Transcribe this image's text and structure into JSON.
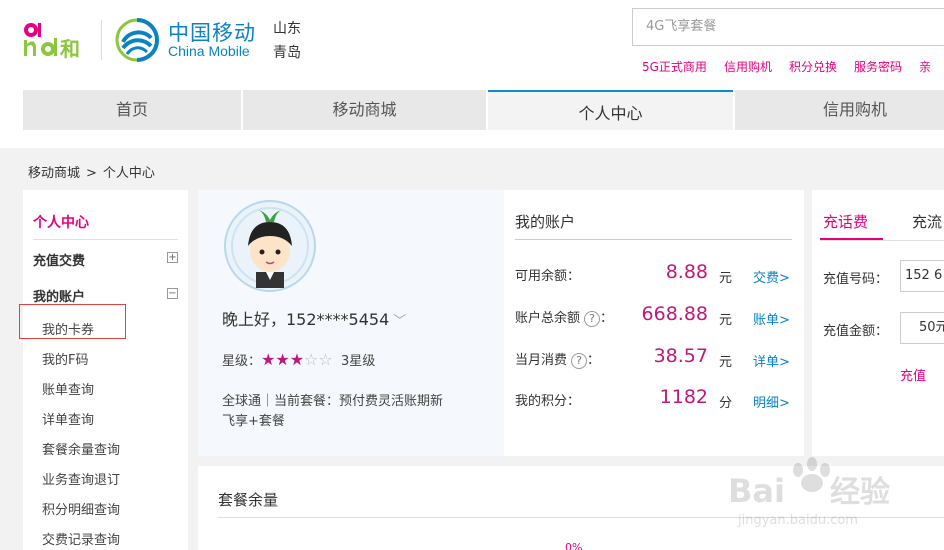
{
  "header": {
    "brand_cn": "中国移动",
    "brand_en": "China Mobile",
    "province": "山东",
    "city": "青岛",
    "search_placeholder": "4G飞享套餐",
    "quick_links": [
      "5G正式商用",
      "信用购机",
      "积分兑换",
      "服务密码",
      "亲"
    ]
  },
  "nav": {
    "items": [
      "首页",
      "移动商城",
      "个人中心",
      "信用购机"
    ],
    "active_index": 2
  },
  "breadcrumb": {
    "parent": "移动商城",
    "separator": ">",
    "current": "个人中心"
  },
  "sidebar": {
    "title": "个人中心",
    "group_recharge": "充值交费",
    "group_account": "我的账户",
    "toggle_plus": "+",
    "toggle_minus": "−",
    "items": [
      "我的卡券",
      "我的F码",
      "账单查询",
      "详单查询",
      "套餐余量查询",
      "业务查询退订",
      "积分明细查询",
      "交费记录查询"
    ],
    "highlighted_item": "我的卡券"
  },
  "profile": {
    "greeting": "晚上好，152****5454",
    "level_label": "星级：",
    "stars_filled": 3,
    "stars_total": 5,
    "level_text": "3星级",
    "package_line1": "全球通｜当前套餐：预付费灵活账期新",
    "package_line2": "飞享+套餐"
  },
  "account": {
    "title": "我的账户",
    "rows": [
      {
        "label": "可用余额：",
        "value": "8.88",
        "unit": "元",
        "link": "交费>"
      },
      {
        "label": "账户总余额",
        "value": "668.88",
        "unit": "元",
        "link": "账单>"
      },
      {
        "label": "当月消费",
        "value": "38.57",
        "unit": "元",
        "link": "详单>"
      },
      {
        "label": "我的积分：",
        "value": "1182",
        "unit": "分",
        "link": "明细>"
      }
    ],
    "help_glyph": "?",
    "colon": "："
  },
  "recharge": {
    "tab_phone": "充话费",
    "tab_data": "充流",
    "number_label": "充值号码：",
    "number_value": "152 6",
    "amount_label": "充值金额：",
    "amount_value": "50元",
    "submit": "充值"
  },
  "balance": {
    "title": "套餐余量",
    "percent": "0%"
  },
  "colors": {
    "accent_pink": "#e4007f",
    "brand_blue": "#0a82c3",
    "value_magenta": "#c0187a"
  }
}
